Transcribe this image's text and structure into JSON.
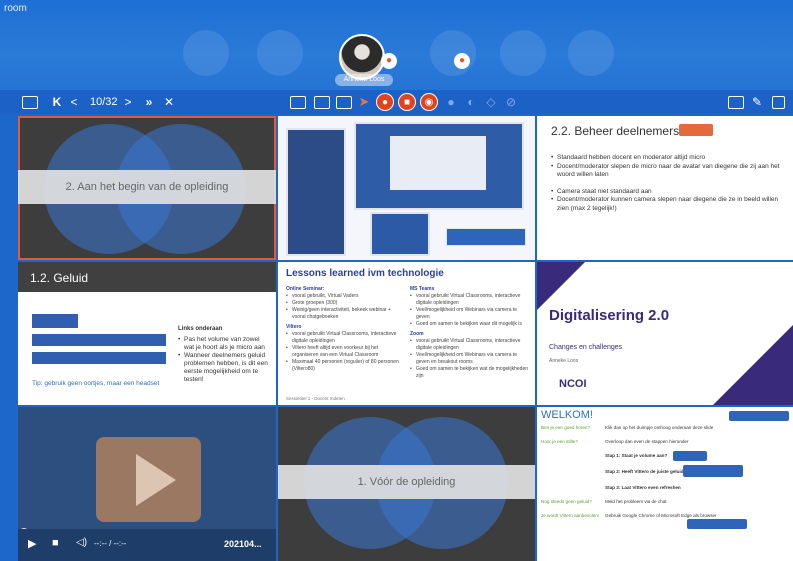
{
  "app": {
    "room_label": "room"
  },
  "presenter": {
    "name": "Anneke Loos"
  },
  "toolbar": {
    "first": "K",
    "prev": "<",
    "page_counter": "10/32",
    "next": ">",
    "last": "»",
    "close": "✕"
  },
  "slides": {
    "s1": {
      "title": "2. Aan het begin van de opleiding"
    },
    "s3": {
      "title": "2.2. Beheer deelnemers",
      "bullets": [
        "Standaard hebben docent en moderator altijd micro",
        "Docent/moderator slepen de micro naar de avatar van diegene die zij aan het woord willen laten",
        "Camera staat niet standaard aan",
        "Docent/moderator kunnen camera slepen naar diegene die ze in beeld willen zien (max 2 tegelijk!)"
      ]
    },
    "s4": {
      "title": "1.2. Geluid",
      "box_heading": "Links onderaan",
      "bullets": [
        "Pas het volume van zowel wat je hoort als je micro aan",
        "Wanneer deelnemers geluid problemen hebben, is dit een eerste mogelijkheid om te testen!"
      ],
      "tip": "Tip: gebruik geen oortjes, maar een headset"
    },
    "s5": {
      "title": "Lessons learned ivm technologie",
      "left_col": [
        {
          "head": "Online Seminar:",
          "items": [
            "vooral gebruikt, Virtual Vaders",
            "Grote groepen (300)",
            "Weinig/geen interactiviteit, bekeek webinar + vooral chatgeboeken"
          ]
        },
        {
          "head": "Viltero",
          "items": [
            "vooral gebruikt Virtual Classrooms, interactieve digitale opleidingen",
            "Viltero heeft altijd even voorkeur bij het organiseren van een Virtual Classroom",
            "Maximaal 40 personen (regulier) of 80 personen (Viltero80)"
          ]
        }
      ],
      "right_col": [
        {
          "head": "MS Teams",
          "items": [
            "vooral gebruikt Virtual Classrooms, interactieve digitale opleidingen",
            "Veel/mogelijkheid om Webinars via camera te geven",
            "Goed om samen te bekijken waar dit mogelijk is"
          ]
        },
        {
          "head": "Zoom",
          "items": [
            "vooral gebruikt Virtual Classrooms, interactieve digitale opleidingen",
            "Veel/mogelijkheid om Webinars via camera te geven en breakout rooms",
            "Goed om samen te bekijken wat de mogelijkheden zijn"
          ]
        }
      ],
      "footer": "Sessietitel 1 - Docent Indeten"
    },
    "s6": {
      "title": "Digitalisering 2.0",
      "subtitle": "Changes en challenges",
      "small": "Anneke Loos",
      "logo": "NCOI"
    },
    "s7": {
      "time": "--:-- / --:--",
      "title": "202104..."
    },
    "s8": {
      "title": "1. Vóór de opleiding"
    },
    "s9": {
      "title": "WELKOM!",
      "rows": [
        {
          "q": "Ben je een goed horen?",
          "a": "Klik dan op het duimpje omhoog onderaan deze slide"
        },
        {
          "q": "Hoor je een stilte?",
          "a": "Overloop dan even de stappen hieronder"
        },
        {
          "q": "",
          "a": "Stap 1: Staat je volume aan?"
        },
        {
          "q": "",
          "a": "Stap 2: Heeft Vittero de juiste geluidsbron?"
        },
        {
          "q": "",
          "a": "Stap 3: Laat Vittero even refreshen"
        },
        {
          "q": "Nog steeds geen geluid?",
          "a": "Meld het probleem via de chat"
        },
        {
          "q": "Je wordt Vittero aanbevolen!",
          "a": "Gebruik Google Chrome of Microsoft Edge als browser"
        }
      ]
    }
  },
  "icons": [
    "slide-view-icon",
    "nav-first-icon",
    "nav-prev-icon",
    "nav-next-icon",
    "nav-last-icon",
    "close-icon",
    "whiteboard-icon",
    "screen-share-icon",
    "media-icon",
    "pointer-icon",
    "mic-icon",
    "camera-icon",
    "record-icon",
    "layout-icon",
    "window-icon",
    "edit-icon",
    "clipboard-icon",
    "play-icon",
    "stop-icon",
    "volume-icon"
  ],
  "colors": {
    "header_blue": "#2576d6",
    "accent_red": "#e1431e",
    "slide_title_blue": "#2c3e9e",
    "ncoi_purple": "#3a2a7c"
  }
}
